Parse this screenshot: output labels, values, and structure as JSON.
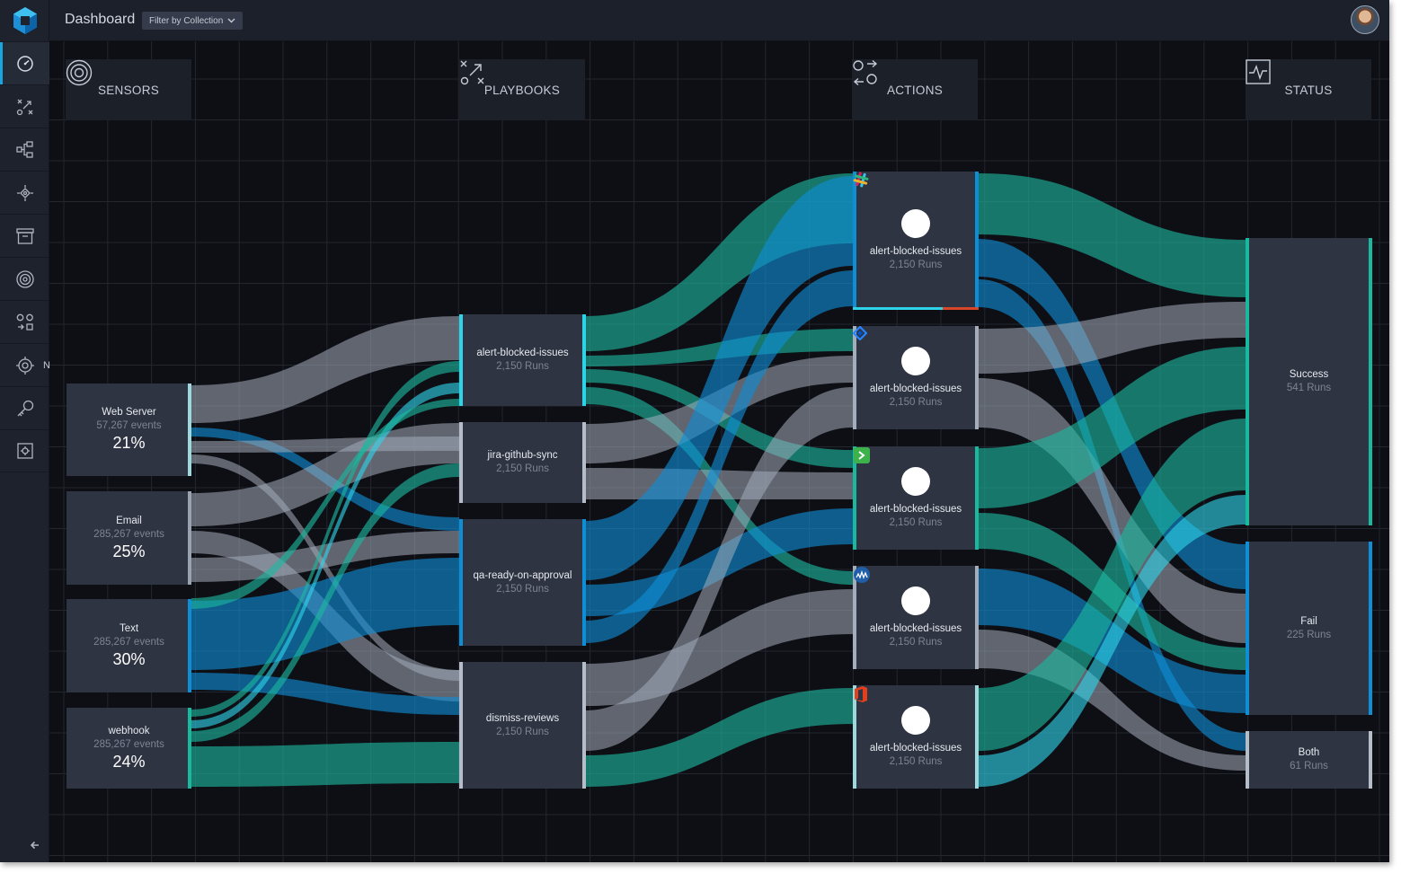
{
  "header": {
    "title": "Dashboard",
    "filter_label": "Filter by Collection"
  },
  "sidebar": {
    "items": [
      {
        "icon": "gauge-icon",
        "active": true
      },
      {
        "icon": "playbooks-icon"
      },
      {
        "icon": "workflow-icon"
      },
      {
        "icon": "rules-icon"
      },
      {
        "icon": "archive-icon"
      },
      {
        "icon": "sensors-icon"
      },
      {
        "icon": "actions-icon"
      },
      {
        "icon": "integrations-icon",
        "badge": "N"
      },
      {
        "icon": "key-icon"
      },
      {
        "icon": "settings-icon"
      }
    ]
  },
  "columns": {
    "sensors": "SENSORS",
    "playbooks": "PLAYBOOKS",
    "actions": "ACTIONS",
    "status": "STATUS"
  },
  "sensors": [
    {
      "name": "Web Server",
      "events": "57,267 events",
      "percent": "21%"
    },
    {
      "name": "Email",
      "events": "285,267 events",
      "percent": "25%"
    },
    {
      "name": "Text",
      "events": "285,267 events",
      "percent": "30%"
    },
    {
      "name": "webhook",
      "events": "285,267 events",
      "percent": "24%"
    }
  ],
  "playbooks": [
    {
      "name": "alert-blocked-issues",
      "runs": "2,150 Runs"
    },
    {
      "name": "jira-github-sync",
      "runs": "2,150 Runs"
    },
    {
      "name": "qa-ready-on-approval",
      "runs": "2,150 Runs"
    },
    {
      "name": "dismiss-reviews",
      "runs": "2,150 Runs"
    }
  ],
  "actions": [
    {
      "name": "alert-blocked-issues",
      "runs": "2,150 Runs",
      "icon": "slack-icon"
    },
    {
      "name": "alert-blocked-issues",
      "runs": "2,150 Runs",
      "icon": "jira-icon"
    },
    {
      "name": "alert-blocked-issues",
      "runs": "2,150 Runs",
      "icon": "terminal-icon"
    },
    {
      "name": "alert-blocked-issues",
      "runs": "2,150 Runs",
      "icon": "wave-icon"
    },
    {
      "name": "alert-blocked-issues",
      "runs": "2,150 Runs",
      "icon": "office-icon"
    }
  ],
  "statuses": [
    {
      "name": "Success",
      "runs": "541 Runs"
    },
    {
      "name": "Fail",
      "runs": "225 Runs"
    },
    {
      "name": "Both",
      "runs": "61 Runs"
    }
  ],
  "colors": {
    "teal": "#1bb8a0",
    "blue": "#0f8ed6",
    "gray": "#a4adbb",
    "cyan": "#2fd3e8"
  }
}
